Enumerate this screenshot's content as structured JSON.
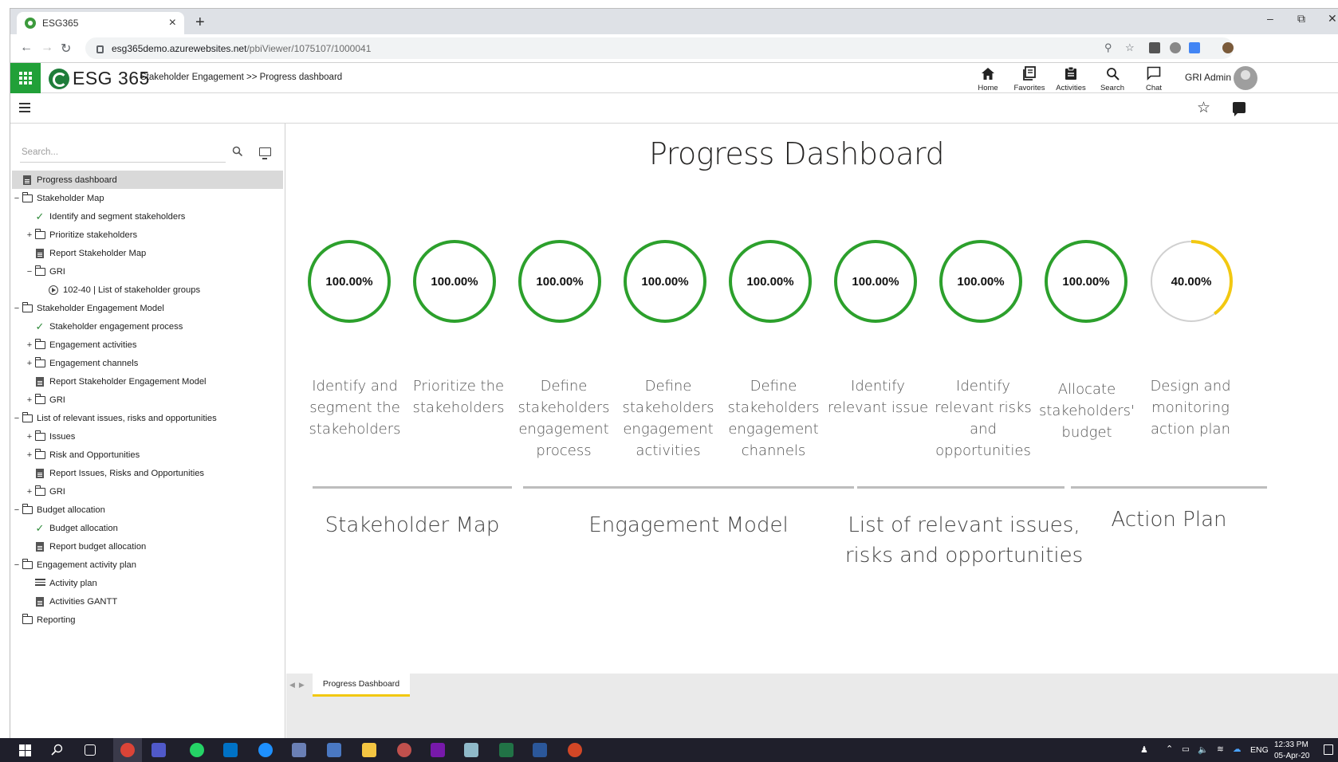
{
  "browser": {
    "tab_title": "ESG365",
    "new_tab_glyph": "+",
    "close_glyph": "×",
    "url_host": "esg365demo.azurewebsites.net",
    "url_path": "/pbiViewer/1075107/1000041"
  },
  "app": {
    "logo_text": "ESG 365",
    "breadcrumb": "Stakeholder Engagement >> Progress dashboard",
    "nav": [
      {
        "label": "Home",
        "icon": "home-icon"
      },
      {
        "label": "Favorites",
        "icon": "favorites-icon"
      },
      {
        "label": "Activities",
        "icon": "activities-icon"
      },
      {
        "label": "Search",
        "icon": "search-icon"
      },
      {
        "label": "Chat",
        "icon": "chat-icon"
      }
    ],
    "user_name": "GRI Admin",
    "brand_color": "#21a038"
  },
  "sidebar": {
    "search_placeholder": "Search...",
    "items": [
      {
        "label": "Progress dashboard",
        "icon": "document-icon",
        "level": 0,
        "toggle": "",
        "selected": true
      },
      {
        "label": "Stakeholder Map",
        "icon": "folder-icon",
        "level": 0,
        "toggle": "−"
      },
      {
        "label": "Identify and segment stakeholders",
        "icon": "check-icon",
        "level": 1,
        "toggle": ""
      },
      {
        "label": "Prioritize stakeholders",
        "icon": "folder-icon",
        "level": 1,
        "toggle": "+"
      },
      {
        "label": "Report Stakeholder Map",
        "icon": "document-icon",
        "level": 1,
        "toggle": ""
      },
      {
        "label": "GRI",
        "icon": "folder-icon",
        "level": 1,
        "toggle": "−"
      },
      {
        "label": "102-40 | List of stakeholder groups",
        "icon": "play-icon",
        "level": 2,
        "toggle": ""
      },
      {
        "label": "Stakeholder Engagement Model",
        "icon": "folder-icon",
        "level": 0,
        "toggle": "−"
      },
      {
        "label": "Stakeholder engagement process",
        "icon": "check-icon",
        "level": 1,
        "toggle": ""
      },
      {
        "label": "Engagement activities",
        "icon": "folder-icon",
        "level": 1,
        "toggle": "+"
      },
      {
        "label": "Engagement channels",
        "icon": "folder-icon",
        "level": 1,
        "toggle": "+"
      },
      {
        "label": "Report Stakeholder Engagement Model",
        "icon": "document-icon",
        "level": 1,
        "toggle": ""
      },
      {
        "label": "GRI",
        "icon": "folder-icon",
        "level": 1,
        "toggle": "+"
      },
      {
        "label": "List of relevant issues, risks and opportunities",
        "icon": "folder-icon",
        "level": 0,
        "toggle": "−"
      },
      {
        "label": "Issues",
        "icon": "folder-icon",
        "level": 1,
        "toggle": "+"
      },
      {
        "label": "Risk and Opportunities",
        "icon": "folder-icon",
        "level": 1,
        "toggle": "+"
      },
      {
        "label": "Report Issues, Risks and Opportunities",
        "icon": "document-icon",
        "level": 1,
        "toggle": ""
      },
      {
        "label": "GRI",
        "icon": "folder-icon",
        "level": 1,
        "toggle": "+"
      },
      {
        "label": "Budget allocation",
        "icon": "folder-icon",
        "level": 0,
        "toggle": "−"
      },
      {
        "label": "Budget allocation",
        "icon": "check-icon",
        "level": 1,
        "toggle": ""
      },
      {
        "label": "Report budget allocation",
        "icon": "document-icon",
        "level": 1,
        "toggle": ""
      },
      {
        "label": "Engagement activity plan",
        "icon": "folder-icon",
        "level": 0,
        "toggle": "−"
      },
      {
        "label": "Activity plan",
        "icon": "list-icon",
        "level": 1,
        "toggle": ""
      },
      {
        "label": "Activities GANTT",
        "icon": "document-icon",
        "level": 1,
        "toggle": ""
      },
      {
        "label": "Reporting",
        "icon": "folder-icon",
        "level": 0,
        "toggle": ""
      }
    ]
  },
  "report": {
    "title": "Progress Dashboard",
    "colors": {
      "complete": "#2ca02c",
      "partial": "#f2c811",
      "track": "#d0d0d0"
    },
    "gauges": [
      {
        "value": 1.0,
        "text": "100.00%",
        "lines": [
          "Identify and",
          "segment the",
          "stakeholders"
        ]
      },
      {
        "value": 1.0,
        "text": "100.00%",
        "lines": [
          "Prioritize the",
          "stakeholders"
        ]
      },
      {
        "value": 1.0,
        "text": "100.00%",
        "lines": [
          "Define",
          "stakeholders",
          "engagement",
          "process"
        ]
      },
      {
        "value": 1.0,
        "text": "100.00%",
        "lines": [
          "Define",
          "stakeholders",
          "engagement",
          "activities"
        ]
      },
      {
        "value": 1.0,
        "text": "100.00%",
        "lines": [
          "Define",
          "stakeholders",
          "engagement",
          "channels"
        ]
      },
      {
        "value": 1.0,
        "text": "100.00%",
        "lines": [
          "Identify",
          "relevant issue"
        ]
      },
      {
        "value": 1.0,
        "text": "100.00%",
        "lines": [
          "Identify",
          "relevant risks",
          "and",
          "opportunities"
        ]
      },
      {
        "value": 1.0,
        "text": "100.00%",
        "lines": [
          "Allocate",
          "stakeholders'",
          "budget"
        ]
      },
      {
        "value": 0.4,
        "text": "40.00%",
        "lines": [
          "Design and",
          "monitoring",
          "action plan"
        ]
      }
    ],
    "sections": [
      {
        "lines": [
          "Stakeholder Map"
        ]
      },
      {
        "lines": [
          "Engagement Model"
        ]
      },
      {
        "lines": [
          "List of relevant issues,",
          "risks and opportunities"
        ]
      },
      {
        "lines": [
          "Action Plan"
        ]
      }
    ],
    "page_tab": "Progress Dashboard"
  },
  "taskbar": {
    "language": "ENG",
    "time": "12:33 PM",
    "date": "05-Apr-20"
  }
}
